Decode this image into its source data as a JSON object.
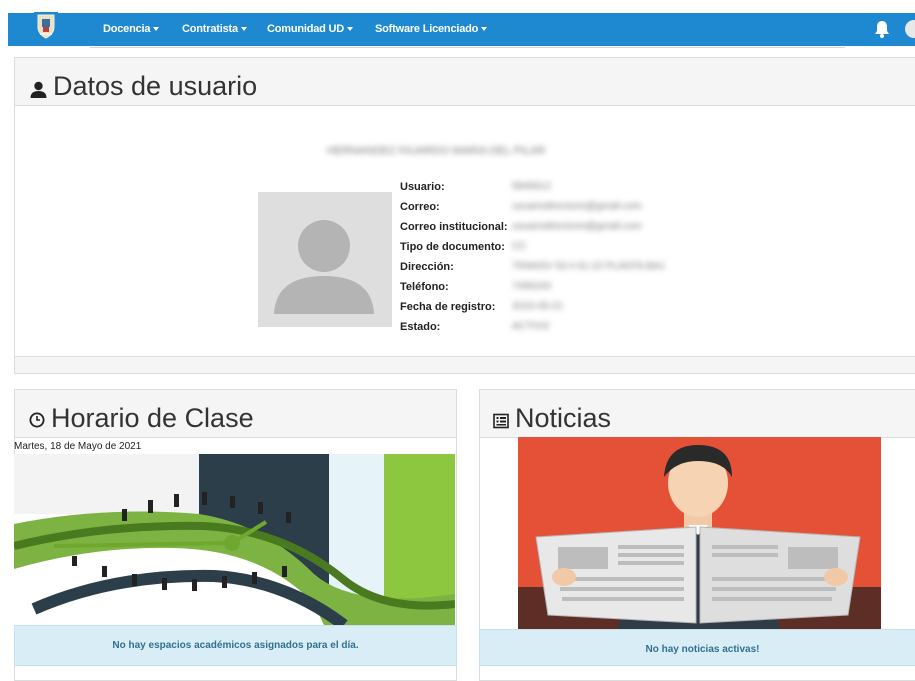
{
  "nav": {
    "items": [
      {
        "label": "Docencia"
      },
      {
        "label": "Contratista"
      },
      {
        "label": "Comunidad UD"
      },
      {
        "label": "Software Licenciado"
      }
    ]
  },
  "profile": {
    "title": "Datos de usuario",
    "name": "HERNANDEZ FAJARDO MARIA DEL PILAR",
    "fields": [
      {
        "label": "Usuario:",
        "value": "5845612"
      },
      {
        "label": "Correo:",
        "value": "usuariodirectorio@gmail.com"
      },
      {
        "label": "Correo institucional:",
        "value": "usuariodirectorio@gmail.com"
      },
      {
        "label": "Tipo de documento:",
        "value": "CC"
      },
      {
        "label": "Dirección:",
        "value": "TRANSV 53 # 61-22 PLANTA BAJ"
      },
      {
        "label": "Teléfono:",
        "value": "7456243"
      },
      {
        "label": "Fecha de registro:",
        "value": "2015-05-21"
      },
      {
        "label": "Estado:",
        "value": "ACTIVO"
      }
    ]
  },
  "schedule": {
    "title": "Horario de Clase",
    "date": "Martes, 18 de Mayo de 2021",
    "empty_message": "No hay espacios académicos asignados para el día."
  },
  "news": {
    "title": "Noticias",
    "empty_message": "No hay noticias activas!"
  },
  "icons": {
    "user": "user-icon",
    "clock": "clock-icon",
    "news": "newspaper-icon",
    "bell": "bell-icon"
  },
  "colors": {
    "navbar": "#1e88d0",
    "alert_bg": "#d9edf7",
    "alert_text": "#31708f",
    "clock_green": "#8dc63f",
    "news_red": "#e55137"
  }
}
